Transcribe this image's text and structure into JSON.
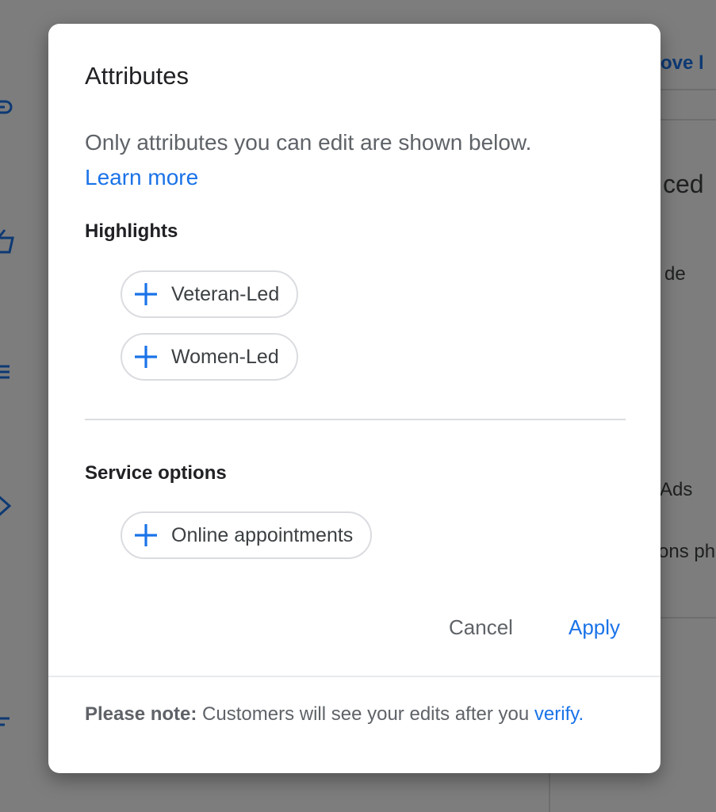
{
  "background": {
    "top_link": "ove l",
    "heading_fragment": "ced",
    "line1": "de",
    "line2": "Ads",
    "line3": "ons ph"
  },
  "dialog": {
    "title": "Attributes",
    "description": "Only attributes you can edit are shown below.",
    "learn_more": "Learn more",
    "sections": [
      {
        "heading": "Highlights",
        "chips": [
          "Veteran-Led",
          "Women-Led"
        ]
      },
      {
        "heading": "Service options",
        "chips": [
          "Online appointments"
        ]
      }
    ],
    "cancel_label": "Cancel",
    "apply_label": "Apply",
    "note_prefix": "Please note:",
    "note_text": " Customers will see your edits after you ",
    "note_link": "verify."
  },
  "colors": {
    "accent": "#1a73e8",
    "text_primary": "#202124",
    "text_secondary": "#5f6368",
    "divider": "#dadce0"
  }
}
